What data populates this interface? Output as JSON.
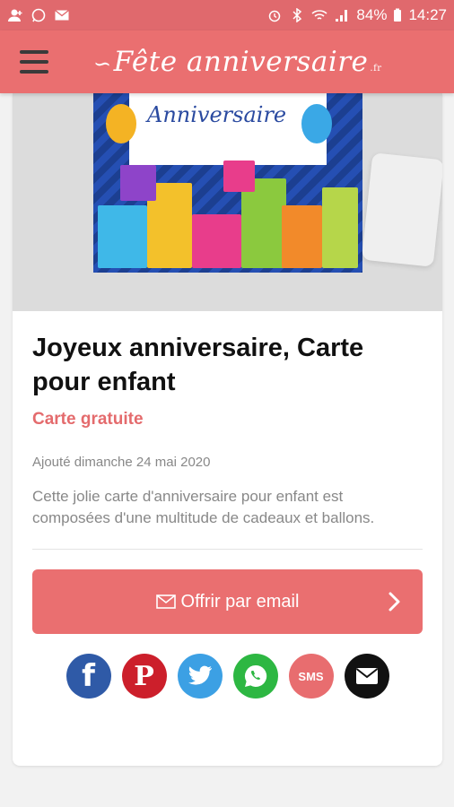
{
  "statusbar": {
    "battery": "84%",
    "time": "14:27"
  },
  "appbar": {
    "logo_main": "Fête anniversaire",
    "logo_tld": ".fr"
  },
  "hero": {
    "card_text": "Anniversaire"
  },
  "article": {
    "title": "Joyeux anniversaire, Carte pour enfant",
    "tag": "Carte gratuite",
    "date": "Ajouté dimanche 24 mai 2020",
    "description": "Cette jolie carte d'anniversaire pour enfant est composées d'une multitude de cadeaux et ballons."
  },
  "actions": {
    "email_label": "Offrir par email"
  },
  "share": {
    "facebook_glyph": "f",
    "pinterest_glyph": "P",
    "sms_label": "SMS"
  },
  "colors": {
    "brand": "#ea6f70",
    "statusbar": "#e0696d",
    "accent_text": "#e46b6d"
  }
}
